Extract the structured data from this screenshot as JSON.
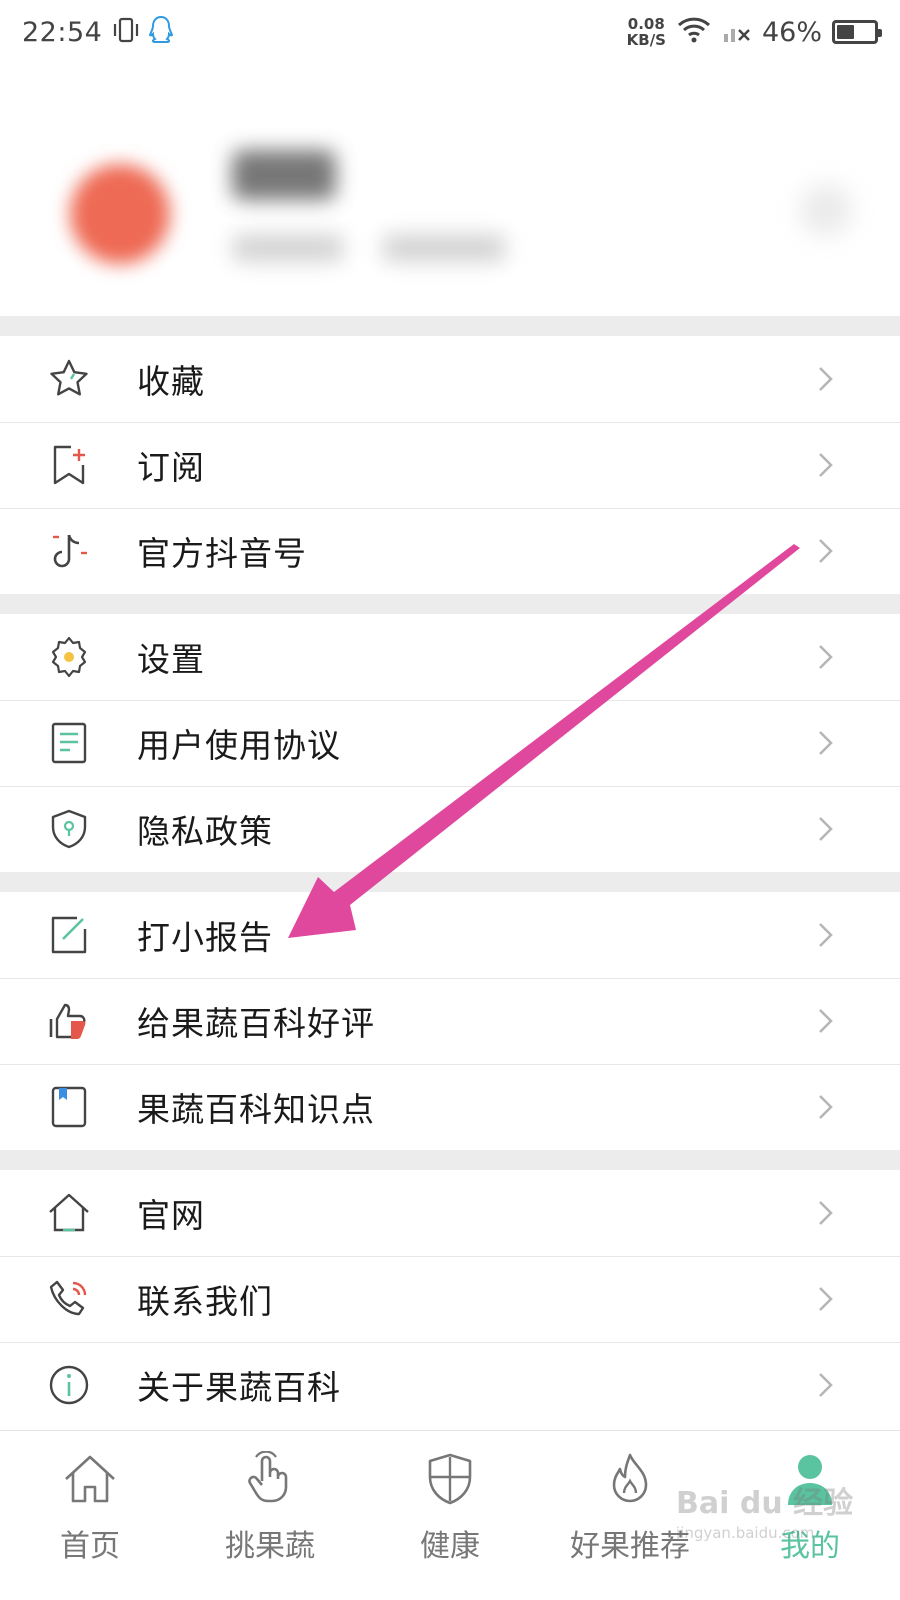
{
  "status_bar": {
    "time": "22:54",
    "net_speed_value": "0.08",
    "net_speed_unit": "KB/S",
    "battery_percent": "46%",
    "battery_level": 0.46
  },
  "menu": {
    "groups": [
      {
        "items": [
          {
            "label": "收藏",
            "icon": "star-icon"
          },
          {
            "label": "订阅",
            "icon": "bookmark-add-icon"
          },
          {
            "label": "官方抖音号",
            "icon": "tiktok-icon"
          }
        ]
      },
      {
        "items": [
          {
            "label": "设置",
            "icon": "gear-icon"
          },
          {
            "label": "用户使用协议",
            "icon": "document-icon"
          },
          {
            "label": "隐私政策",
            "icon": "shield-icon"
          }
        ]
      },
      {
        "items": [
          {
            "label": "打小报告",
            "icon": "edit-icon"
          },
          {
            "label": "给果蔬百科好评",
            "icon": "thumbs-up-icon"
          },
          {
            "label": "果蔬百科知识点",
            "icon": "book-icon"
          }
        ]
      },
      {
        "items": [
          {
            "label": "官网",
            "icon": "home-icon"
          },
          {
            "label": "联系我们",
            "icon": "phone-icon"
          },
          {
            "label": "关于果蔬百科",
            "icon": "info-icon"
          }
        ]
      }
    ]
  },
  "bottom_nav": {
    "items": [
      {
        "label": "首页",
        "icon": "home-icon"
      },
      {
        "label": "挑果蔬",
        "icon": "hand-pointer-icon"
      },
      {
        "label": "健康",
        "icon": "shield-icon"
      },
      {
        "label": "好果推荐",
        "icon": "flame-icon"
      },
      {
        "label": "我的",
        "icon": "user-icon"
      }
    ],
    "active_index": 4
  },
  "watermark": {
    "main": "Bai du 经验",
    "sub": "jingyan.baidu.com"
  },
  "colors": {
    "accent": "#5ac3a0",
    "annotation_arrow": "#e0489e"
  }
}
